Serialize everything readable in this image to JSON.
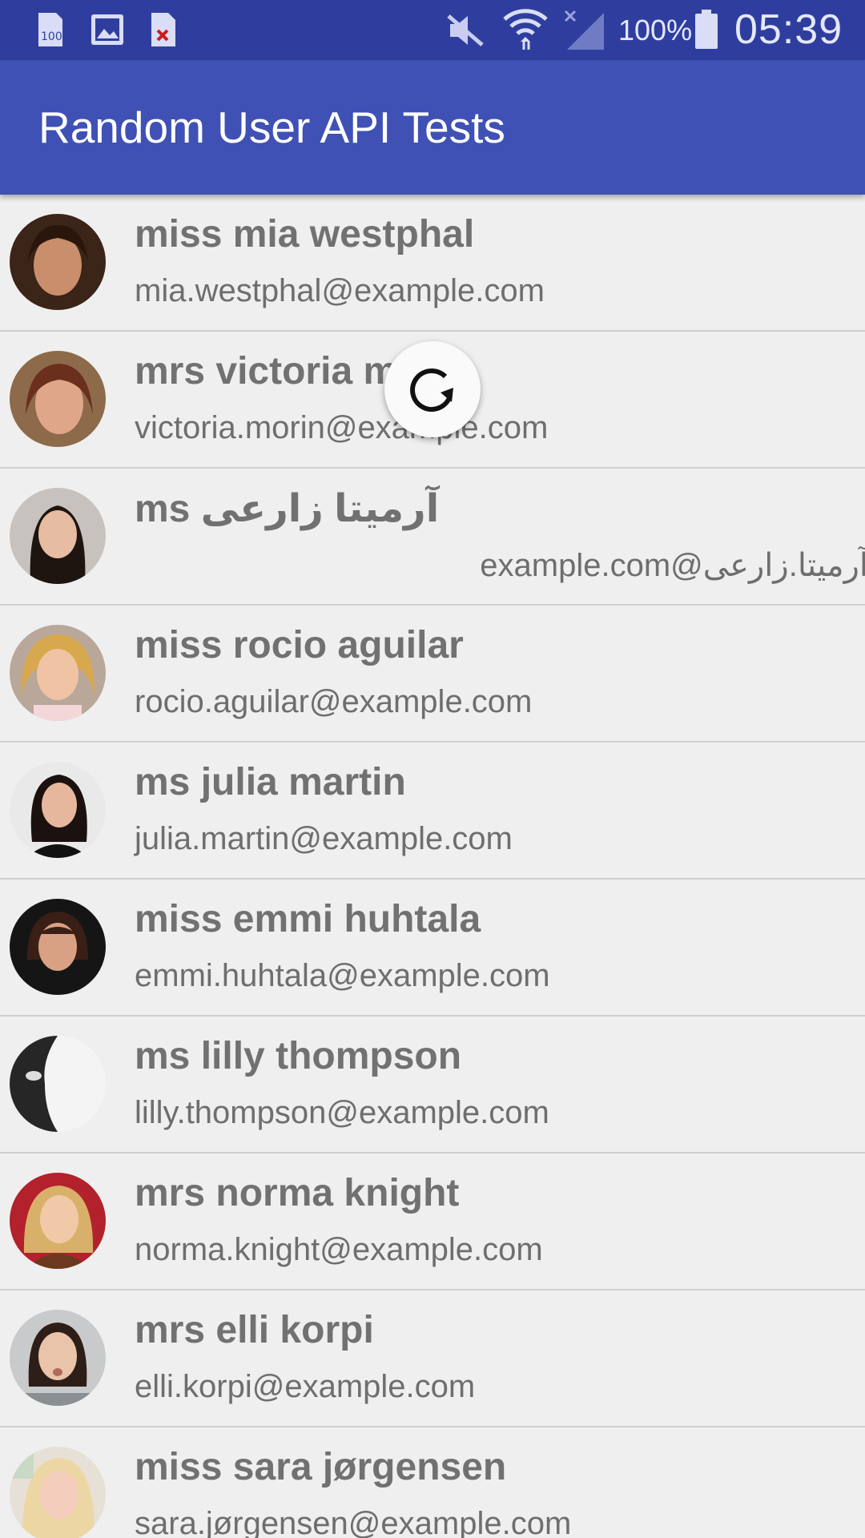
{
  "status_bar": {
    "battery_percent": "100%",
    "time": "05:39",
    "icons": [
      "sd-card-icon",
      "image-icon",
      "file-error-icon",
      "mute-icon",
      "wifi-icon",
      "no-signal-icon",
      "battery-icon"
    ]
  },
  "app_bar": {
    "title": "Random User API Tests"
  },
  "colors": {
    "status_bar": "#2f3e9e",
    "app_bar": "#3f51b5",
    "list_background": "#efefef"
  },
  "users": [
    {
      "name": "miss mia westphal",
      "email": "mia.westphal@example.com"
    },
    {
      "name": "mrs victoria morin",
      "email": "victoria.morin@example.com"
    },
    {
      "name": "ms آرمیتا زارعی",
      "email": "آرمیتا.زارعی@example.com"
    },
    {
      "name": "miss rocio aguilar",
      "email": "rocio.aguilar@example.com"
    },
    {
      "name": "ms julia martin",
      "email": "julia.martin@example.com"
    },
    {
      "name": "miss emmi huhtala",
      "email": "emmi.huhtala@example.com"
    },
    {
      "name": "ms lilly thompson",
      "email": "lilly.thompson@example.com"
    },
    {
      "name": "mrs norma knight",
      "email": "norma.knight@example.com"
    },
    {
      "name": "mrs elli korpi",
      "email": "elli.korpi@example.com"
    },
    {
      "name": "miss sara jørgensen",
      "email": "sara.jørgensen@example.com"
    }
  ],
  "refresh_indicator": {
    "icon": "refresh-icon"
  }
}
